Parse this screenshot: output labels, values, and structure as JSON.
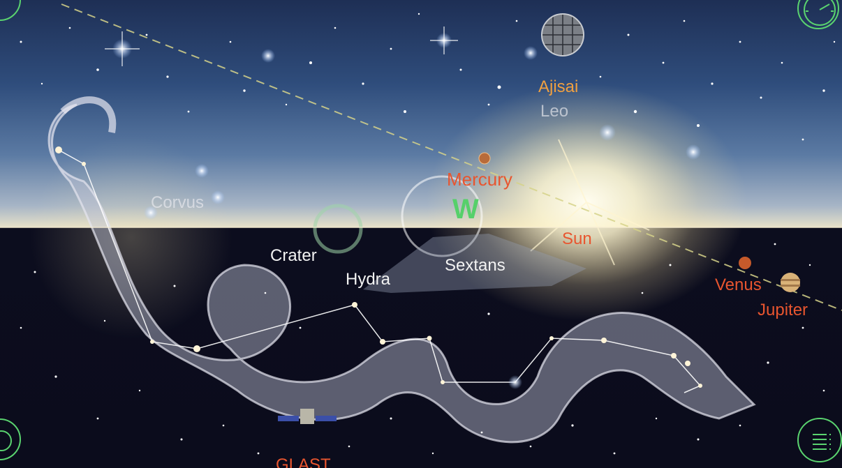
{
  "labels": {
    "ajisai": "Ajisai",
    "leo": "Leo",
    "mercury": "Mercury",
    "compass_w": "W",
    "corvus": "Corvus",
    "crater": "Crater",
    "hydra": "Hydra",
    "sextans": "Sextans",
    "sun": "Sun",
    "venus": "Venus",
    "jupiter": "Jupiter",
    "glast": "GLAST"
  },
  "colors": {
    "accent_green": "#5ad36f",
    "planet_label": "#e8552f",
    "satellite_label": "#f0a040"
  },
  "icons": {
    "top_left": "circle-button-icon",
    "top_right": "clock-icon",
    "bottom_left": "circle-button-icon",
    "bottom_right": "menu-icon"
  }
}
